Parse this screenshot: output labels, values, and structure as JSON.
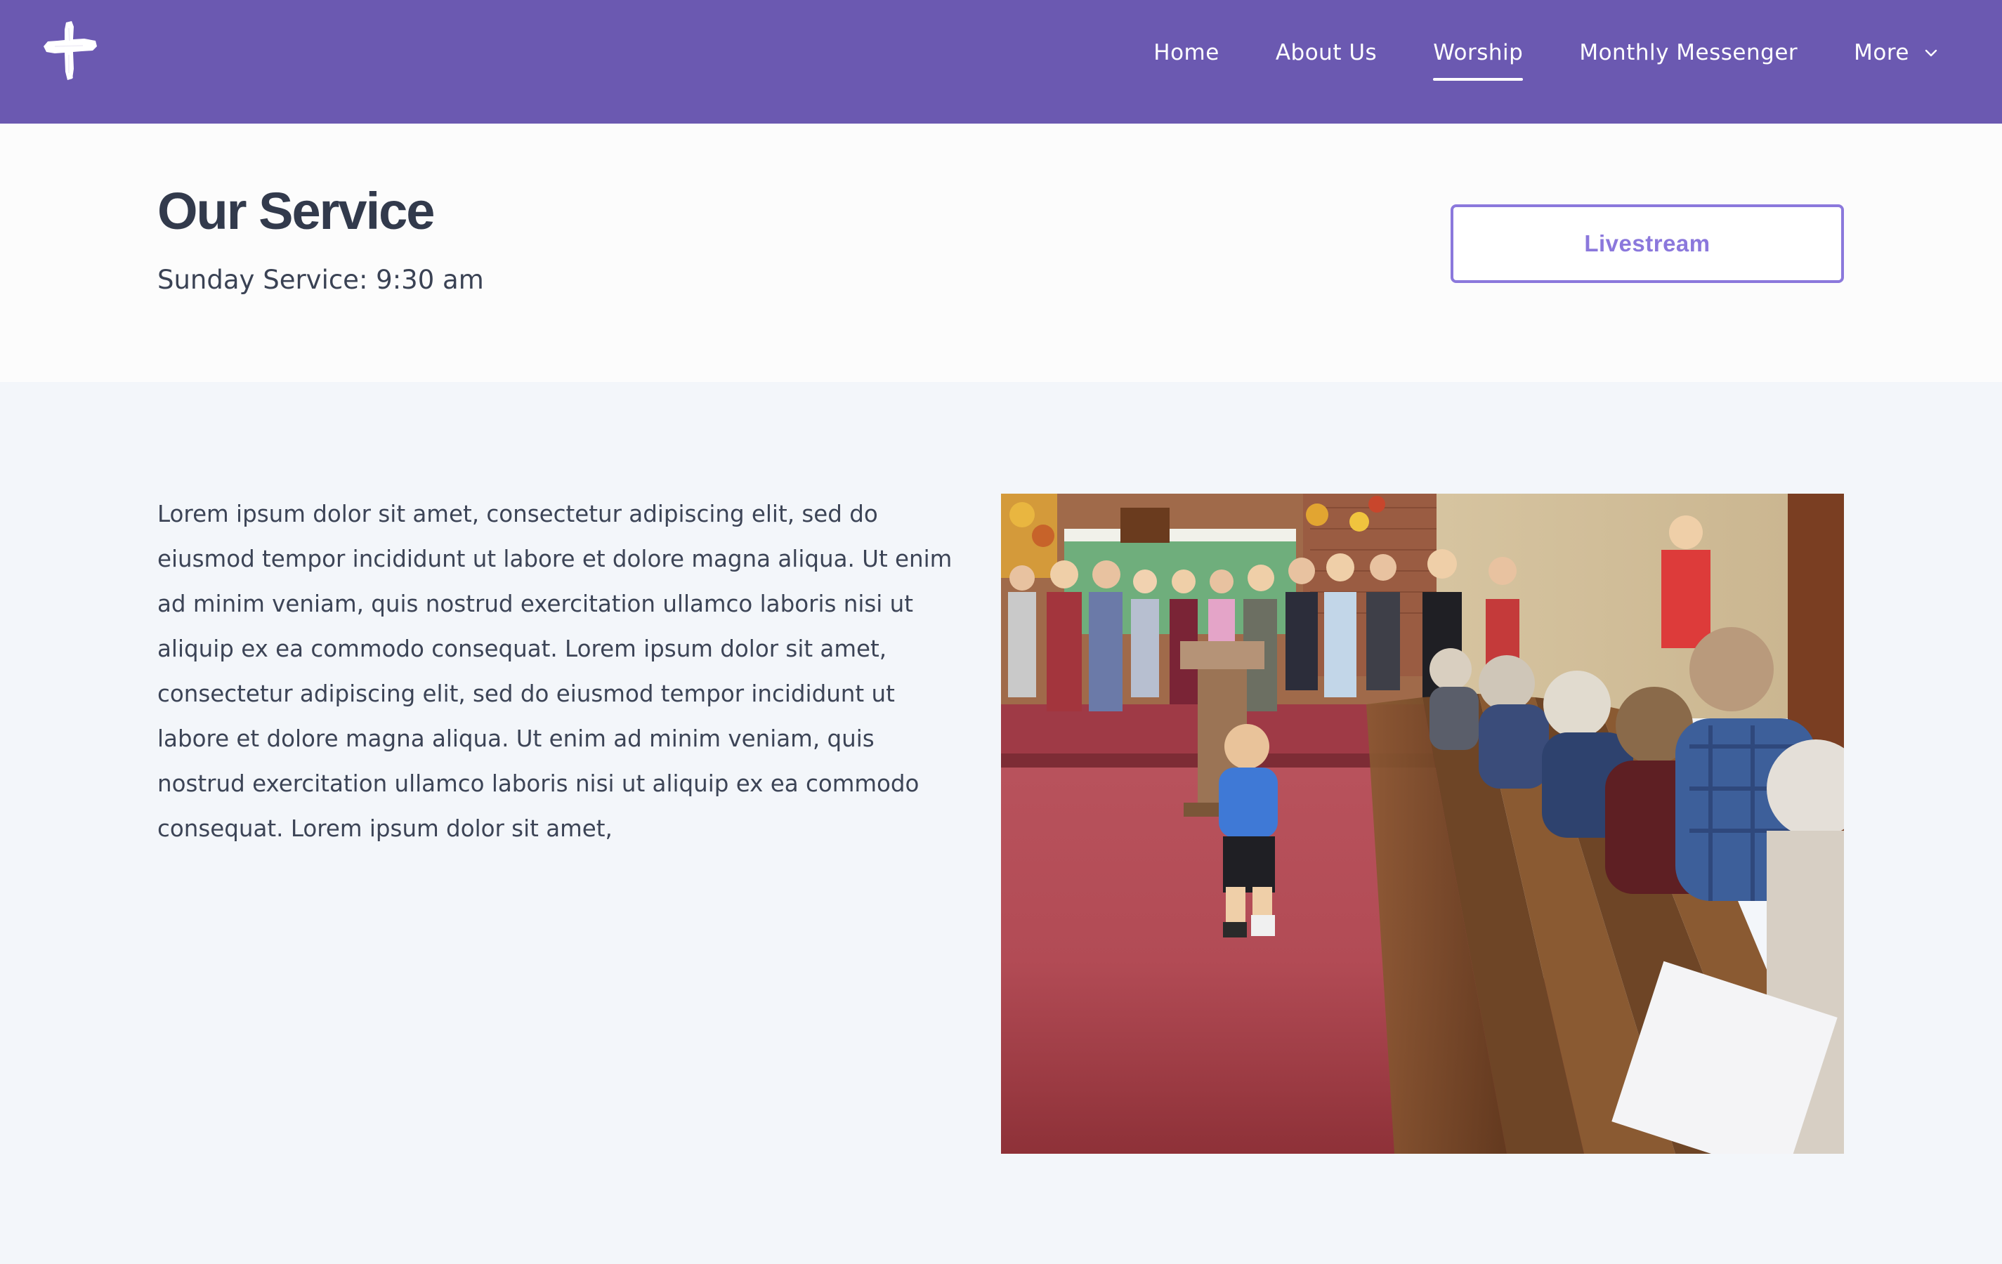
{
  "header": {
    "logo_icon": "cross-icon",
    "background_color": "#6b59b1",
    "nav": [
      {
        "label": "Home",
        "active": false
      },
      {
        "label": "About Us",
        "active": false
      },
      {
        "label": "Worship",
        "active": true
      },
      {
        "label": "Monthly Messenger",
        "active": false
      },
      {
        "label": "More",
        "active": false,
        "icon": "chevron-down-icon"
      }
    ]
  },
  "hero": {
    "title": "Our Service",
    "subtitle": "Sunday Service: 9:30 am",
    "livestream_label": "Livestream",
    "accent_color": "#8b78dc"
  },
  "main": {
    "paragraph": "Lorem ipsum dolor sit amet, consectetur adipiscing elit, sed do eiusmod tempor incididunt ut labore et dolore magna aliqua. Ut enim ad minim veniam, quis nostrud exercitation ullamco laboris nisi ut aliquip ex ea commodo consequat. Lorem ipsum dolor sit amet, consectetur adipiscing elit, sed do eiusmod tempor incididunt ut labore et dolore magna aliqua. Ut enim ad minim veniam, quis nostrud exercitation ullamco laboris nisi ut aliquip ex ea commodo consequat. Lorem ipsum dolor sit amet,"
  }
}
